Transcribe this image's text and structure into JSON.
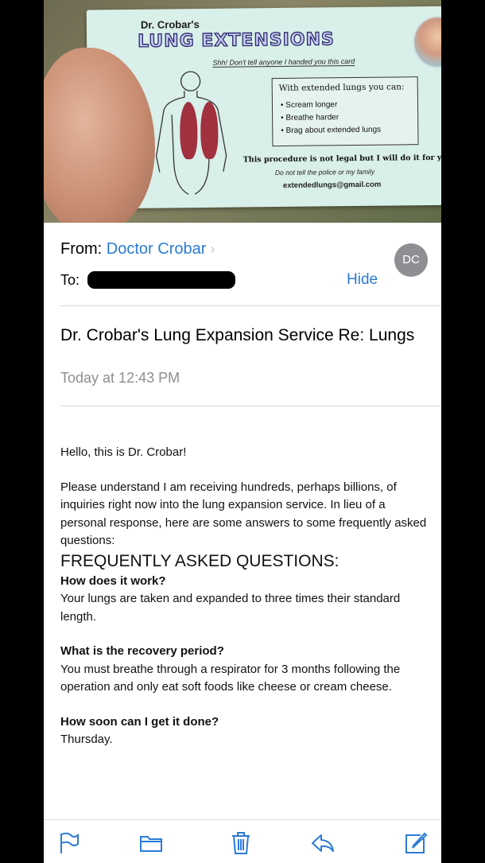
{
  "card": {
    "doctor": "Dr. Crobar's",
    "title": "LUNG EXTENSIONS",
    "secret": "Shh! Don't tell anyone I handed you this card",
    "box_heading": "With extended lungs you can:",
    "benefits": [
      "Scream longer",
      "Breathe harder",
      "Brag about extended lungs"
    ],
    "legal": "This procedure is not legal but I will do it for you",
    "police": "Do not tell the police or my family",
    "email": "extendedlungs@gmail.com"
  },
  "mail": {
    "from_label": "From:",
    "sender": "Doctor Crobar",
    "avatar_initials": "DC",
    "to_label": "To:",
    "hide_label": "Hide",
    "subject": "Dr. Crobar's Lung Expansion Service Re: Lungs",
    "date": "Today at 12:43 PM",
    "greeting": "Hello, this is Dr. Crobar!",
    "intro": "Please understand I am receiving hundreds, perhaps billions, of inquiries right now into the lung expansion service. In lieu of a personal response, here are some answers to some frequently asked questions:",
    "faq_heading": "FREQUENTLY ASKED QUESTIONS:",
    "faq": [
      {
        "q": "How does it work?",
        "a": "Your lungs are taken and expanded to three times their standard length."
      },
      {
        "q": "What is the recovery period?",
        "a": "You must breathe through a respirator for 3 months following the operation and only eat soft foods like cheese or cream cheese."
      },
      {
        "q": "How soon can I get it done?",
        "a": "Thursday."
      }
    ]
  },
  "toolbar": {
    "icons": [
      "flag-icon",
      "folder-icon",
      "trash-icon",
      "reply-icon",
      "compose-icon"
    ],
    "accent": "#2b7bd6"
  }
}
